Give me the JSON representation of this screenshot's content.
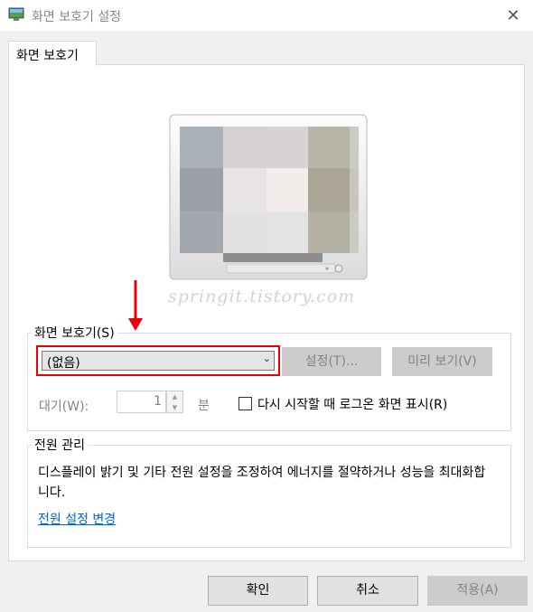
{
  "window": {
    "title": "화면 보호기 설정",
    "close_glyph": "✕"
  },
  "tabs": [
    {
      "label": "화면 보호기"
    }
  ],
  "preview": {
    "watermark": "springit.tistory.com"
  },
  "screensaver": {
    "group_label": "화면 보호기(S)",
    "selected": "(없음)",
    "settings_button": "설정(T)...",
    "preview_button": "미리 보기(V)",
    "wait_label": "대기(W):",
    "wait_value": "1",
    "wait_unit": "분",
    "resume_checkbox_label": "다시 시작할 때 로그온 화면 표시(R)",
    "resume_checked": false
  },
  "power": {
    "group_label": "전원 관리",
    "description": "디스플레이 밝기 및 기타 전원 설정을 조정하여 에너지를 절약하거나 성능을 최대화합니다.",
    "link": "전원 설정 변경"
  },
  "footer": {
    "ok": "확인",
    "cancel": "취소",
    "apply": "적용(A)"
  },
  "colors": {
    "highlight_red": "#e8000b",
    "link_blue": "#0066cc"
  }
}
